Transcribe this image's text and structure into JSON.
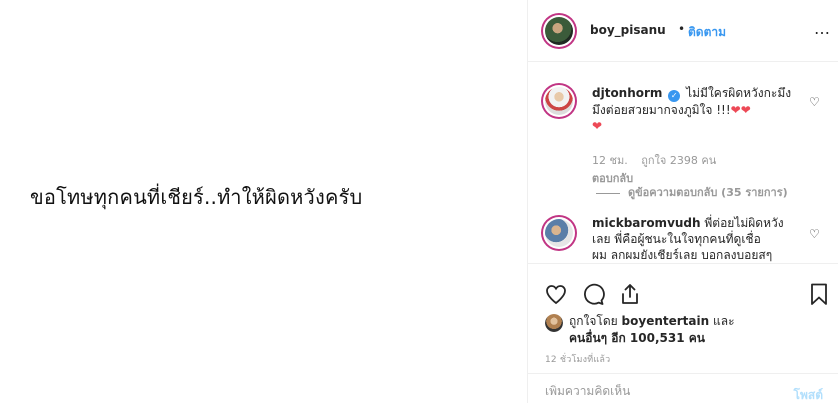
{
  "media": {
    "caption_text": "ขอโทษทุกคนที่เชียร์..ทำให้ผิดหวังครับ"
  },
  "header": {
    "username": "boy_pisanu",
    "separator": "•",
    "follow_label": "ติดตาม",
    "more_icon": "…"
  },
  "comments": [
    {
      "username": "djtonhorm",
      "verified": true,
      "text_line1": "ไม่มีใครผิดหวังกะมึง",
      "text_line2": "มึงต่อยสวยมากจงภูมิใจ !!!",
      "hearts_inline": "❤❤",
      "hearts_line3": "❤",
      "time": "12 ชม.",
      "likes": "ถูกใจ 2398 คน",
      "reply_label": "ตอบกลับ",
      "view_replies": "ดูข้อความตอบกลับ (35 รายการ)"
    },
    {
      "username": "mickbaromvudh",
      "verified": false,
      "text_line1": "พี่ต่อยไม่ผิดหวัง",
      "text_line2": "เลย พี่คือผู้ชนะในใจทุกคนที่ดูเชื่อ",
      "text_line3": "ผม ลกผมยังเชียร์เลย บอกลงบอยสๆ"
    }
  ],
  "likes": {
    "prefix": "ถูกใจโดย",
    "user": "boyentertain",
    "and": "และ",
    "others": "คนอื่นๆ อีก 100,531 คน"
  },
  "time_ago": "12 ชั่วโมงที่แล้ว",
  "add_comment": {
    "placeholder": "เพิ่มความคิดเห็น",
    "post_label": "โพสต์"
  },
  "colors": {
    "accent": "#3897f0",
    "heart": "#ed4956",
    "muted": "#999999"
  }
}
